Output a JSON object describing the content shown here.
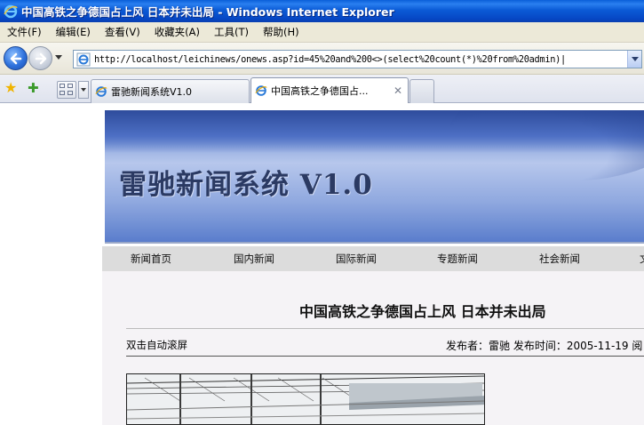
{
  "window": {
    "title": "中国高铁之争德国占上风 日本并未出局 - Windows Internet Explorer"
  },
  "menu": {
    "items": [
      "文件(F)",
      "编辑(E)",
      "查看(V)",
      "收藏夹(A)",
      "工具(T)",
      "帮助(H)"
    ]
  },
  "address": {
    "url": "http://localhost/leichinews/onews.asp?id=45%20and%200<>(select%20count(*)%20from%20admin)|"
  },
  "tabs": [
    {
      "label": "雷驰新闻系统V1.0",
      "active": false
    },
    {
      "label": "中国高铁之争德国占...",
      "active": true
    }
  ],
  "site": {
    "banner_title": "雷驰新闻系统 V1.0",
    "nav": [
      "新闻首页",
      "国内新闻",
      "国际新闻",
      "专题新闻",
      "社会新闻",
      "文"
    ]
  },
  "article": {
    "headline": "中国高铁之争德国占上风 日本并未出局",
    "autoscroll": "双击自动滚屏",
    "meta": "发布者：雷驰 发布时间：2005-11-19 阅"
  },
  "colors": {
    "titlebar": "#0b5bd6",
    "chrome": "#ece9d8",
    "banner": "#8fa8df",
    "navstrip": "#dcdcdc"
  }
}
